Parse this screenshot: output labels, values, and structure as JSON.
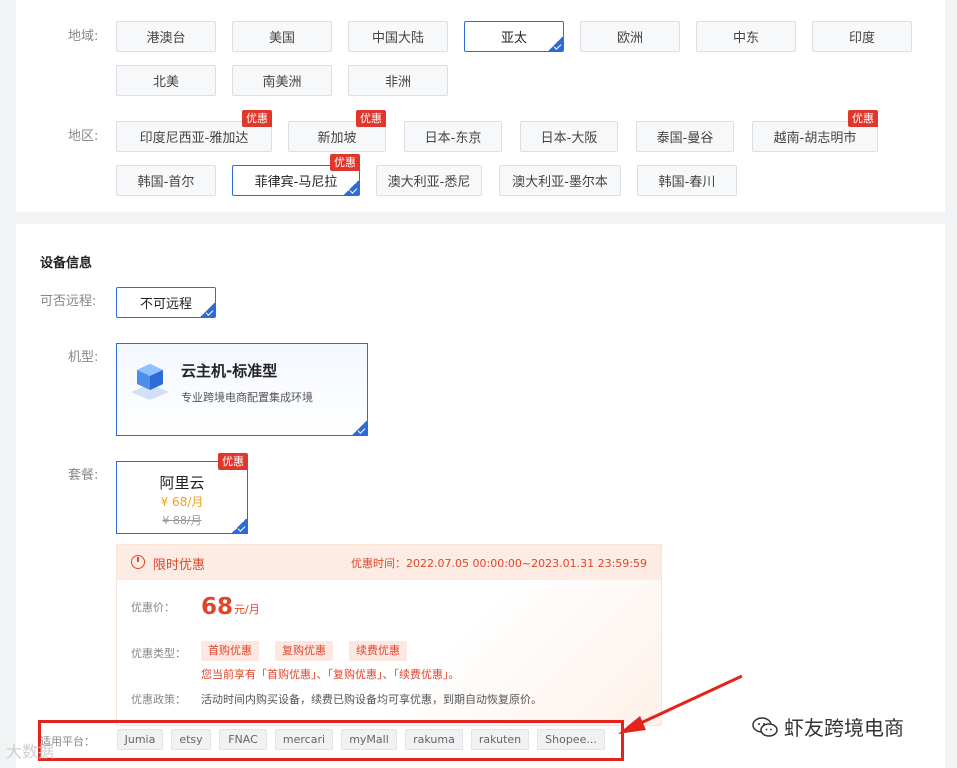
{
  "region_row": {
    "label": "地域:",
    "items": [
      {
        "label": "港澳台"
      },
      {
        "label": "美国"
      },
      {
        "label": "中国大陆"
      },
      {
        "label": "亚太",
        "selected": true
      },
      {
        "label": "欧洲"
      },
      {
        "label": "中东"
      },
      {
        "label": "印度"
      },
      {
        "label": "北美"
      },
      {
        "label": "南美洲"
      },
      {
        "label": "非洲"
      }
    ]
  },
  "area_row": {
    "label": "地区:",
    "items": [
      {
        "label": "印度尼西亚-雅加达",
        "promo": "优惠"
      },
      {
        "label": "新加坡",
        "promo": "优惠"
      },
      {
        "label": "日本-东京"
      },
      {
        "label": "日本-大阪"
      },
      {
        "label": "泰国-曼谷"
      },
      {
        "label": "越南-胡志明市",
        "promo": "优惠"
      },
      {
        "label": "韩国-首尔"
      },
      {
        "label": "菲律宾-马尼拉",
        "promo": "优惠",
        "selected": true
      },
      {
        "label": "澳大利亚-悉尼"
      },
      {
        "label": "澳大利亚-墨尔本"
      },
      {
        "label": "韩国-春川"
      }
    ]
  },
  "device": {
    "section_title": "设备信息",
    "remote_label": "可否远程:",
    "remote_value": "不可远程",
    "model_label": "机型:",
    "model_title": "云主机-标准型",
    "model_subtitle": "专业跨境电商配置集成环境",
    "plan_label": "套餐:",
    "plan_name": "阿里云",
    "plan_price": "¥ 68/月",
    "plan_old_price": "¥ 88/月",
    "plan_promo": "优惠"
  },
  "offer": {
    "title": "限时优惠",
    "time": "优惠时间：2022.07.05 00:00:00~2023.01.31 23:59:59",
    "price_label": "优惠价：",
    "price": "68",
    "unit": "元/月",
    "type_label": "优惠类型：",
    "types": [
      "首购优惠",
      "复购优惠",
      "续费优惠"
    ],
    "note": "您当前享有「首购优惠」、「复购优惠」、「续费优惠」。",
    "policy_label": "优惠政策：",
    "policy": "活动时间内购买设备，续费已购设备均可享优惠，到期自动恢复原价。"
  },
  "platforms": {
    "label": "适用平台：",
    "items": [
      "Jumia",
      "etsy",
      "FNAC",
      "mercari",
      "myMall",
      "rakuma",
      "rakuten",
      "Shopee..."
    ]
  },
  "watermark": {
    "right": "虾友跨境电商",
    "left": "大数据"
  },
  "colors": {
    "accent": "#2f6bd6",
    "promo": "#e0362c",
    "highlight_box": "#e3241c"
  }
}
